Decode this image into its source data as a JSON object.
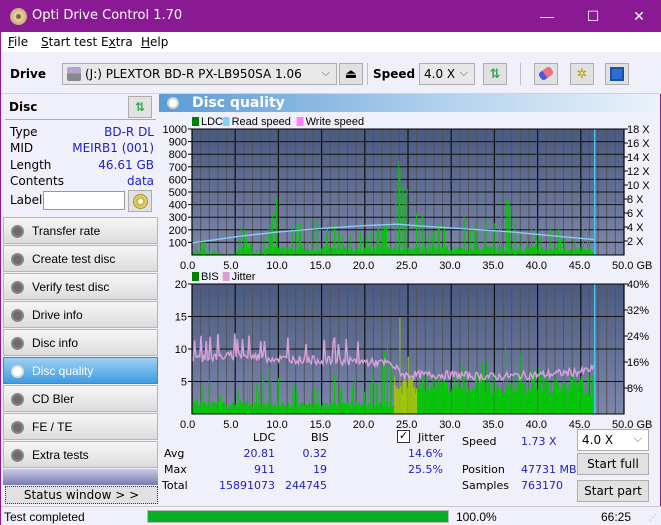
{
  "window": {
    "title": "Opti Drive Control 1.70",
    "minimize": "—",
    "maximize": "☐",
    "close": "✕"
  },
  "menu": [
    {
      "label": "File",
      "accel": "F"
    },
    {
      "label": "Start test",
      "accel": "S"
    },
    {
      "label": "Extra",
      "accel": "t"
    },
    {
      "label": "Help",
      "accel": "H"
    }
  ],
  "toolbar": {
    "drive_label": "Drive",
    "drive_value": "(J:)  PLEXTOR BD-R  PX-LB950SA 1.06",
    "speed_label": "Speed",
    "speed_value": "4.0 X",
    "icons": [
      "eject-icon",
      "refresh-icon",
      "eraser-icon",
      "settings-icon",
      "save-icon"
    ]
  },
  "disc": {
    "header": "Disc",
    "fields": [
      {
        "key": "Type",
        "value": "BD-R DL"
      },
      {
        "key": "MID",
        "value": "MEIRB1 (001)"
      },
      {
        "key": "Length",
        "value": "46.61 GB"
      },
      {
        "key": "Contents",
        "value": "data"
      }
    ],
    "label_key": "Label",
    "label_value": ""
  },
  "nav": [
    {
      "label": "Transfer rate",
      "active": false
    },
    {
      "label": "Create test disc",
      "active": false
    },
    {
      "label": "Verify test disc",
      "active": false
    },
    {
      "label": "Drive info",
      "active": false
    },
    {
      "label": "Disc info",
      "active": false
    },
    {
      "label": "Disc quality",
      "active": true
    },
    {
      "label": "CD Bler",
      "active": false
    },
    {
      "label": "FE / TE",
      "active": false
    },
    {
      "label": "Extra tests",
      "active": false
    }
  ],
  "status_window_button": "Status window > >",
  "panel_title": "Disc quality",
  "chart_data": [
    {
      "type": "bar",
      "title": "LDC",
      "legend": [
        {
          "name": "LDC",
          "color": "#008000"
        },
        {
          "name": "Read speed",
          "color": "#87cefa"
        },
        {
          "name": "Write speed",
          "color": "#ff80ff"
        }
      ],
      "legend_position": "top-left",
      "xlabel": "GB",
      "x_ticks": [
        "0.0",
        "5.0",
        "10.0",
        "15.0",
        "20.0",
        "25.0",
        "30.0",
        "35.0",
        "40.0",
        "45.0",
        "50.0 GB"
      ],
      "xlim": [
        0,
        50
      ],
      "y_ticks": [
        "100",
        "200",
        "300",
        "400",
        "500",
        "600",
        "700",
        "800",
        "900",
        "1000"
      ],
      "ylim": [
        0,
        1000
      ],
      "y2_ticks": [
        "2 X",
        "4 X",
        "6 X",
        "8 X",
        "10 X",
        "12 X",
        "14 X",
        "16 X",
        "18 X"
      ],
      "y2lim": [
        0,
        18
      ],
      "end_marker_gb": 46.61,
      "ldc_profile": [
        {
          "x": 0,
          "y": 15
        },
        {
          "x": 1,
          "y": 250
        },
        {
          "x": 2,
          "y": 20
        },
        {
          "x": 3,
          "y": 60
        },
        {
          "x": 4,
          "y": 15
        },
        {
          "x": 5,
          "y": 30
        },
        {
          "x": 5.5,
          "y": 250
        },
        {
          "x": 6.5,
          "y": 200
        },
        {
          "x": 7.5,
          "y": 40
        },
        {
          "x": 9,
          "y": 280
        },
        {
          "x": 9.5,
          "y": 520
        },
        {
          "x": 10.5,
          "y": 300
        },
        {
          "x": 12,
          "y": 320
        },
        {
          "x": 13.5,
          "y": 240
        },
        {
          "x": 14,
          "y": 360
        },
        {
          "x": 15,
          "y": 260
        },
        {
          "x": 16,
          "y": 280
        },
        {
          "x": 17,
          "y": 260
        },
        {
          "x": 18,
          "y": 220
        },
        {
          "x": 20,
          "y": 250
        },
        {
          "x": 21.5,
          "y": 300
        },
        {
          "x": 22.5,
          "y": 330
        },
        {
          "x": 23.5,
          "y": 650
        },
        {
          "x": 24,
          "y": 911
        },
        {
          "x": 24.5,
          "y": 650
        },
        {
          "x": 25,
          "y": 560
        },
        {
          "x": 26,
          "y": 350
        },
        {
          "x": 27,
          "y": 300
        },
        {
          "x": 28,
          "y": 320
        },
        {
          "x": 30,
          "y": 300
        },
        {
          "x": 31,
          "y": 340
        },
        {
          "x": 33,
          "y": 320
        },
        {
          "x": 35,
          "y": 300
        },
        {
          "x": 37,
          "y": 560
        },
        {
          "x": 38,
          "y": 280
        },
        {
          "x": 40,
          "y": 250
        },
        {
          "x": 42,
          "y": 230
        },
        {
          "x": 44,
          "y": 200
        },
        {
          "x": 46,
          "y": 230
        },
        {
          "x": 46.61,
          "y": 60
        }
      ],
      "read_speed": [
        {
          "x": 0,
          "y": 1.73
        },
        {
          "x": 5,
          "y": 2.6
        },
        {
          "x": 10,
          "y": 3.3
        },
        {
          "x": 15,
          "y": 3.8
        },
        {
          "x": 20,
          "y": 4.2
        },
        {
          "x": 23.8,
          "y": 4.4
        },
        {
          "x": 27,
          "y": 4.1
        },
        {
          "x": 32,
          "y": 3.7
        },
        {
          "x": 37,
          "y": 3.3
        },
        {
          "x": 42,
          "y": 2.7
        },
        {
          "x": 46.61,
          "y": 2.2
        }
      ]
    },
    {
      "type": "bar",
      "title": "BIS / Jitter",
      "legend": [
        {
          "name": "BIS",
          "color": "#008000"
        },
        {
          "name": "Jitter",
          "color": "#d8a0d8"
        }
      ],
      "legend_position": "top-left",
      "xlabel": "GB",
      "x_ticks": [
        "0.0",
        "5.0",
        "10.0",
        "15.0",
        "20.0",
        "25.0",
        "30.0",
        "35.0",
        "40.0",
        "45.0",
        "50.0 GB"
      ],
      "xlim": [
        0,
        50
      ],
      "y_ticks": [
        "5",
        "10",
        "15",
        "20"
      ],
      "ylim": [
        0,
        20
      ],
      "y2_ticks": [
        "8%",
        "16%",
        "24%",
        "32%",
        "40%"
      ],
      "y2lim": [
        0,
        40
      ],
      "end_marker_gb": 46.61,
      "bis_profile": [
        {
          "x": 0,
          "y": 2
        },
        {
          "x": 2,
          "y": 6
        },
        {
          "x": 4,
          "y": 2
        },
        {
          "x": 6,
          "y": 5
        },
        {
          "x": 9.5,
          "y": 8.5
        },
        {
          "x": 12,
          "y": 6
        },
        {
          "x": 15,
          "y": 7
        },
        {
          "x": 18,
          "y": 6
        },
        {
          "x": 21,
          "y": 7
        },
        {
          "x": 23.5,
          "y": 15
        },
        {
          "x": 23.8,
          "y": 19
        },
        {
          "x": 25,
          "y": 12
        },
        {
          "x": 27,
          "y": 9
        },
        {
          "x": 30,
          "y": 8
        },
        {
          "x": 33,
          "y": 9
        },
        {
          "x": 37,
          "y": 12
        },
        {
          "x": 40,
          "y": 8
        },
        {
          "x": 43,
          "y": 7
        },
        {
          "x": 46.61,
          "y": 3
        }
      ],
      "jitter_profile": [
        {
          "x": 0,
          "y": 17
        },
        {
          "x": 5,
          "y": 18
        },
        {
          "x": 10,
          "y": 17
        },
        {
          "x": 15,
          "y": 16.5
        },
        {
          "x": 20,
          "y": 16
        },
        {
          "x": 23,
          "y": 15.5
        },
        {
          "x": 24.5,
          "y": 12
        },
        {
          "x": 30,
          "y": 12
        },
        {
          "x": 35,
          "y": 11.5
        },
        {
          "x": 40,
          "y": 12
        },
        {
          "x": 45,
          "y": 13
        },
        {
          "x": 46.61,
          "y": 14
        }
      ]
    }
  ],
  "stats": {
    "col_ldc": "LDC",
    "col_bis": "BIS",
    "jitter_label": "Jitter",
    "jitter_checked": true,
    "rows": [
      {
        "label": "Avg",
        "ldc": "20.81",
        "bis": "0.32",
        "jitter": "14.6%"
      },
      {
        "label": "Max",
        "ldc": "911",
        "bis": "19",
        "jitter": "25.5%"
      },
      {
        "label": "Total",
        "ldc": "15891073",
        "bis": "244745",
        "jitter": ""
      }
    ],
    "speed_label": "Speed",
    "speed_value": "1.73 X",
    "position_label": "Position",
    "position_value": "47731 MB",
    "samples_label": "Samples",
    "samples_value": "763170",
    "speed_select": "4.0 X",
    "start_full": "Start full",
    "start_part": "Start part"
  },
  "statusbar": {
    "text": "Test completed",
    "progress": 100.0,
    "progress_text": "100.0%",
    "time": "66:25"
  }
}
